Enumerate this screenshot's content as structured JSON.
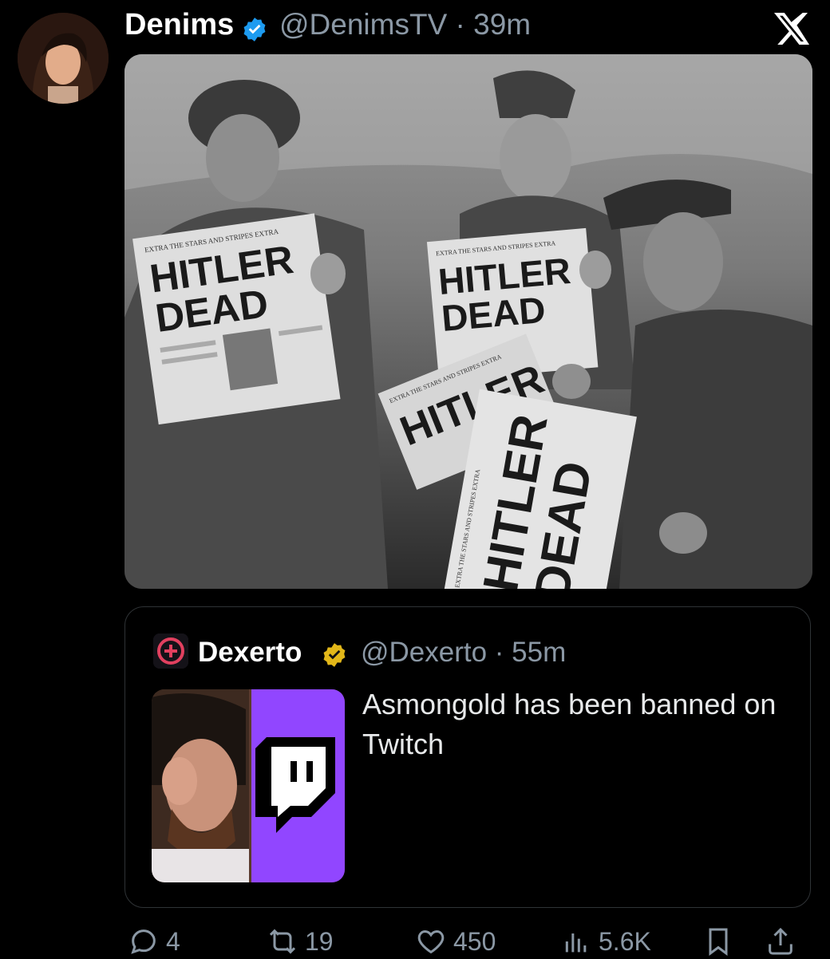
{
  "tweet": {
    "author_name": "Denims",
    "handle_time": "@DenimsTV · 39m",
    "image": {
      "newspaper_header": "EXTRA  THE STARS AND STRIPES  EXTRA",
      "headline_1": "HITLER",
      "headline_2": "DEAD"
    }
  },
  "quoted": {
    "author_name": "Dexerto",
    "handle_time": "@Dexerto · 55m",
    "text": "Asmongold has been banned on Twitch"
  },
  "actions": {
    "replies": "4",
    "reposts": "19",
    "likes": "450",
    "views": "5.6K"
  },
  "colors": {
    "background": "#000000",
    "secondary_text": "#8b98a5",
    "verified_blue": "#1d9bf0",
    "verified_gold": "#e2b719",
    "twitch_purple": "#9146ff"
  },
  "icons": [
    "x-logo-icon",
    "verified-blue-icon",
    "verified-gold-icon",
    "reply-icon",
    "repost-icon",
    "like-icon",
    "views-icon",
    "bookmark-icon",
    "share-icon",
    "twitch-logo-icon"
  ]
}
